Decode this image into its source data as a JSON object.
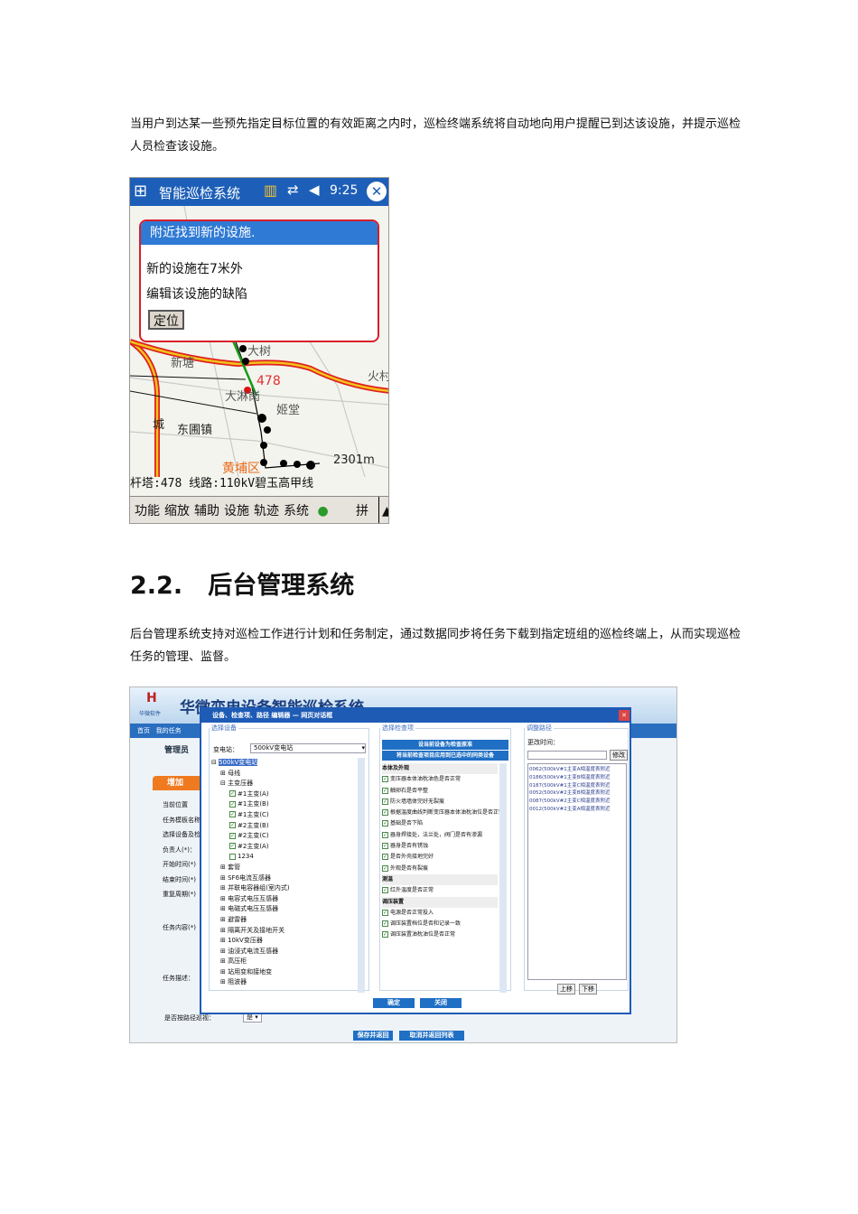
{
  "intro_text": "当用户到达某一些预先指定目标位置的有效距离之内时，巡检终端系统将自动地向用户提醒已到达该设施，并提示巡检人员检查该设施。",
  "mobile": {
    "app_title": "智能巡检系统",
    "time": "9:25",
    "popup": {
      "title": "附近找到新的设施.",
      "line1": "新的设施在7米外",
      "line2": "编辑该设施的缺陷",
      "locate_button": "定位"
    },
    "map_labels": {
      "tower_id": "478",
      "place1": "新塘",
      "place2": "大淋岗",
      "place3": "姬堂",
      "place4": "东圃镇",
      "place5": "黄埔区",
      "place6": "火村",
      "place7": "城",
      "place8": "大树",
      "scale": "2301m"
    },
    "status": "杆塔:478  线路:110kV碧玉高甲线",
    "menu": [
      "功能",
      "缩放",
      "辅助",
      "设施",
      "轨迹",
      "系统"
    ],
    "input_method": "拼",
    "colors": {
      "header": "#1d5fb8",
      "popup_border": "#d81e2a",
      "route": "#f0c419"
    }
  },
  "section": {
    "number": "2.2.",
    "title": "后台管理系统"
  },
  "body_text": "后台管理系统支持对巡检工作进行计划和任务制定，通过数据同步将任务下载到指定班组的巡检终端上，从而实现巡检任务的管理、监督。",
  "backend": {
    "logo": "华微软件",
    "system_title": "华微变电设备智能巡检系统",
    "nav": [
      "首页",
      "我的任务"
    ],
    "panel_title": "管理员",
    "add_tab": "增加",
    "form_labels": [
      "当前位置",
      "任务模板名称",
      "选择设备及检查项",
      "负责人(*)：",
      "开始时间(*)",
      "结束时间(*)",
      "重复周期(*)",
      "任务内容(*)",
      "任务描述："
    ],
    "route_label": "是否按路径巡视：",
    "route_value": "是",
    "save_button": "保存并返回",
    "cancel_button": "取消并返回列表",
    "dialog": {
      "title": "设备、检查项、路径 编辑器 — 网页对话框",
      "device_legend": "选择设备",
      "station_label": "变电站：",
      "station_value": "500kV变电站",
      "tree_root": "500kV变电站",
      "tree": [
        {
          "t": "母线",
          "lv": 1
        },
        {
          "t": "主变压器",
          "lv": 1
        },
        {
          "t": "#1主变(A)",
          "lv": 2,
          "c": true
        },
        {
          "t": "#1主变(B)",
          "lv": 2,
          "c": true
        },
        {
          "t": "#1主变(C)",
          "lv": 2,
          "c": true
        },
        {
          "t": "#2主变(B)",
          "lv": 2,
          "c": true
        },
        {
          "t": "#2主变(C)",
          "lv": 2,
          "c": true
        },
        {
          "t": "#2主变(A)",
          "lv": 2,
          "c": true
        },
        {
          "t": "1234",
          "lv": 2,
          "c": false
        },
        {
          "t": "套管",
          "lv": 1
        },
        {
          "t": "SF6电流互感器",
          "lv": 1
        },
        {
          "t": "并联电容器组(室内式)",
          "lv": 1
        },
        {
          "t": "电容式电压互感器",
          "lv": 1
        },
        {
          "t": "电磁式电压互感器",
          "lv": 1
        },
        {
          "t": "避雷器",
          "lv": 1
        },
        {
          "t": "隔离开关及接地开关",
          "lv": 1
        },
        {
          "t": "10kV变压器",
          "lv": 1
        },
        {
          "t": "油浸式电流互感器",
          "lv": 1
        },
        {
          "t": "高压柜",
          "lv": 1
        },
        {
          "t": "站用变和接地变",
          "lv": 1
        },
        {
          "t": "阻波器",
          "lv": 1
        }
      ],
      "check_legend": "选择检查项",
      "check_btn1": "设当前设备为检查原准",
      "check_btn2": "将当前检查项目应用到已选中的同类设备",
      "checks": [
        {
          "t": "本体及外观",
          "g": true
        },
        {
          "t": "变压器本体油枕油色是否正常"
        },
        {
          "t": "触卵石是否平整"
        },
        {
          "t": "防火墙墙体完好无裂痕"
        },
        {
          "t": "根据温度曲线判断变压器本体油枕油位是否正常"
        },
        {
          "t": "基础是否下陷"
        },
        {
          "t": "器身焊接处，法兰处，阀门是否有渗漏"
        },
        {
          "t": "器身是否有锈蚀"
        },
        {
          "t": "是否外壳接地完好"
        },
        {
          "t": "外观是否有裂痕"
        },
        {
          "t": "测温",
          "g": true
        },
        {
          "t": "红外温度是否正常"
        },
        {
          "t": "调压装置",
          "g": true
        },
        {
          "t": "电源是否正常投入"
        },
        {
          "t": "调压装置档位是否和记录一致"
        },
        {
          "t": "调压装置油枕油位是否正常"
        }
      ],
      "path_legend": "调整路径",
      "path_time_label": "更改时间：",
      "modify_button": "修改",
      "path_items": [
        "0062(500kV#1主变A相温度表附近",
        "0186(500kV#1主变B相温度表附近",
        "0187(500kV#1主变C相温度表附近",
        "0052(500kV#2主变B相温度表附近",
        "0087(500kV#2主变C相温度表附近",
        "0012(500kV#2主变A相温度表附近"
      ],
      "up_button": "上移",
      "down_button": "下移",
      "ok_button": "确定",
      "close_button": "关闭"
    }
  }
}
